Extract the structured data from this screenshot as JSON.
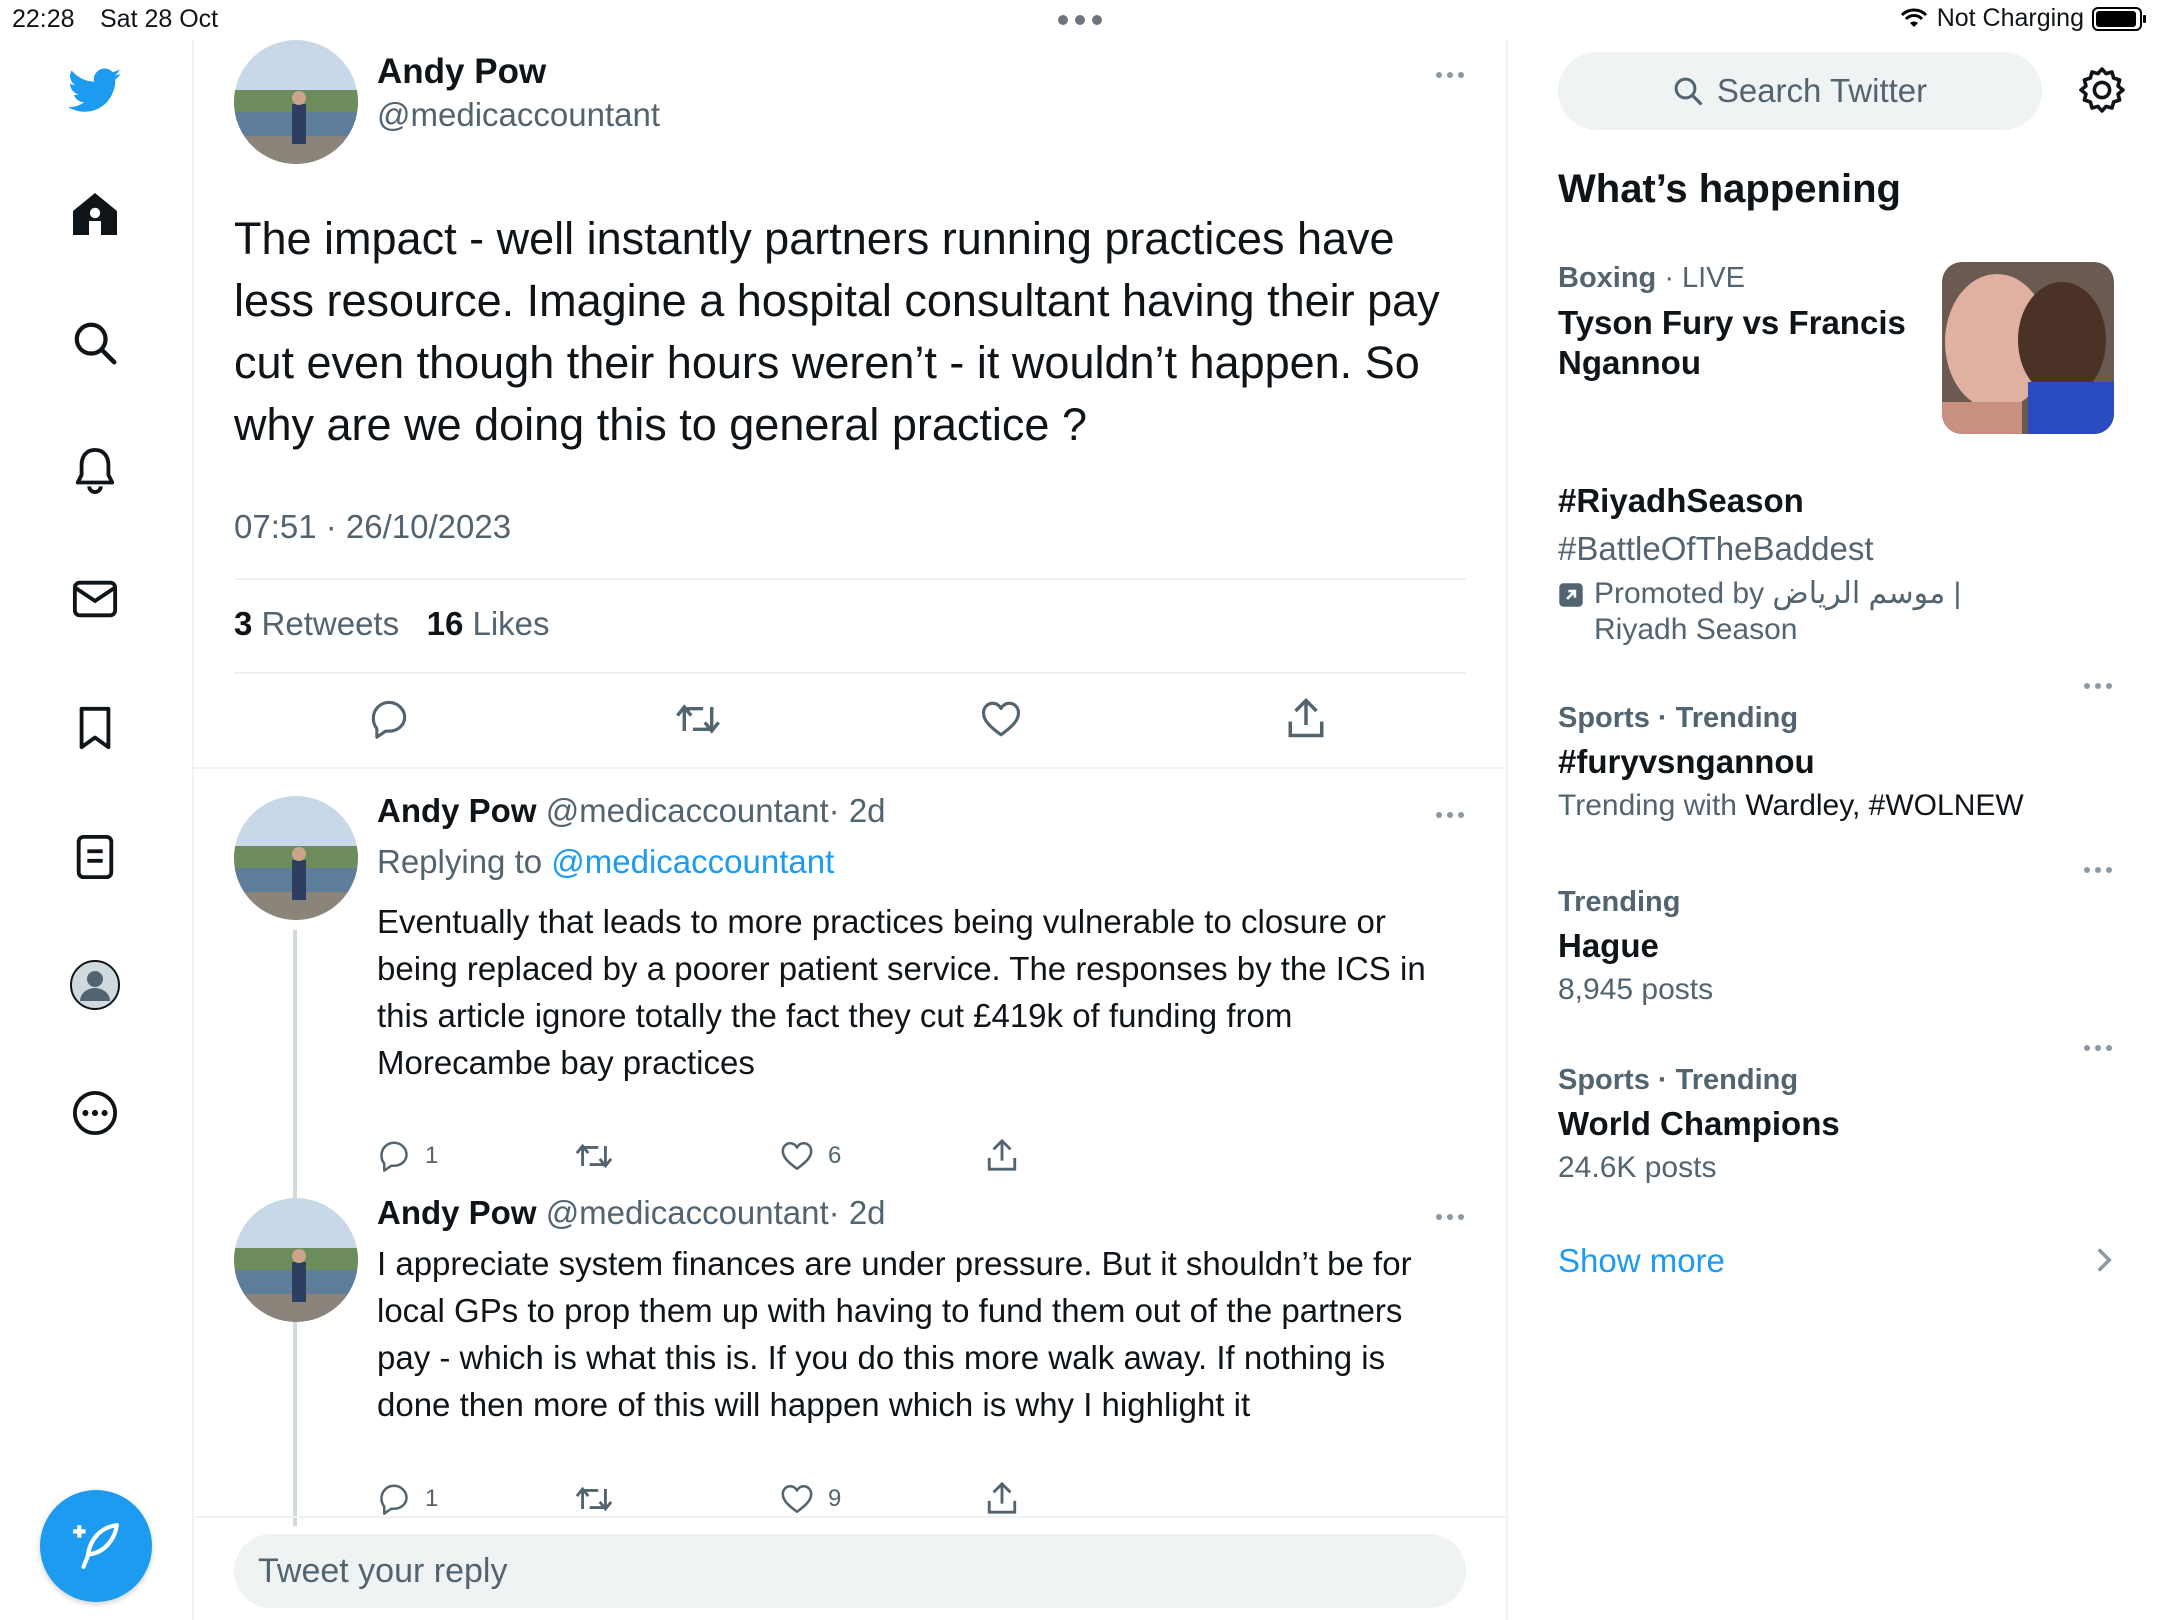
{
  "status_bar": {
    "time": "22:28",
    "date": "Sat 28 Oct",
    "network": "Not Charging"
  },
  "colors": {
    "accent": "#1d9bf0",
    "text": "#0f1419",
    "muted": "#536471",
    "divider": "#eff3f4"
  },
  "nav": {
    "items": [
      "home-icon",
      "search-icon",
      "bell-icon",
      "mail-icon",
      "bookmark-icon",
      "lists-icon",
      "profile-icon",
      "more-icon"
    ]
  },
  "main_tweet": {
    "name": "Andy Pow",
    "handle": "@medicaccountant",
    "text": "The impact - well instantly partners running practices have less resource. Imagine a hospital consultant having their pay cut even though their hours weren’t - it wouldn’t happen. So why are we doing this to general practice ?",
    "timestamp": "07:51 · 26/10/2023",
    "retweets_count": "3",
    "retweets_label": "Retweets",
    "likes_count": "16",
    "likes_label": "Likes"
  },
  "replies": [
    {
      "name": "Andy Pow",
      "handle": "@medicaccountant",
      "age": "· 2d",
      "replying_label": "Replying to",
      "replying_handle": "@medicaccountant",
      "text": "Eventually that leads to more practices being vulnerable to closure or being replaced by a poorer patient service. The responses by the ICS in this article ignore totally the fact they cut £419k of funding from Morecambe bay practices",
      "reply_count": "1",
      "like_count": "6"
    },
    {
      "name": "Andy Pow",
      "handle": "@medicaccountant",
      "age": "· 2d",
      "text": "I appreciate system finances are under pressure. But it shouldn’t be for local GPs to prop them up with having to fund them out of the partners pay - which is what this is. If you do this more walk away. If nothing is done then more of this will happen which is why I highlight it",
      "reply_count": "1",
      "like_count": "9"
    }
  ],
  "reply_box": {
    "placeholder": "Tweet your reply"
  },
  "sidebar": {
    "search_placeholder": "Search Twitter",
    "heading": "What’s happening",
    "trends": [
      {
        "category": "Boxing",
        "live": "· LIVE",
        "title": "Tyson Fury vs Francis Ngannou"
      },
      {
        "title": "#RiyadhSeason",
        "subtitle": "#BattleOfTheBaddest",
        "promoted": "Promoted by موسم الرياض | Riyadh Season"
      },
      {
        "meta": "Sports · Trending",
        "title": "#furyvsngannou",
        "sub_prefix": "Trending with",
        "sub_items": "Wardley, #WOLNEW"
      },
      {
        "meta": "Trending",
        "title": "Hague",
        "count": "8,945 posts"
      },
      {
        "meta": "Sports · Trending",
        "title": "World Champions",
        "count": "24.6K posts"
      }
    ],
    "show_more": "Show more"
  }
}
